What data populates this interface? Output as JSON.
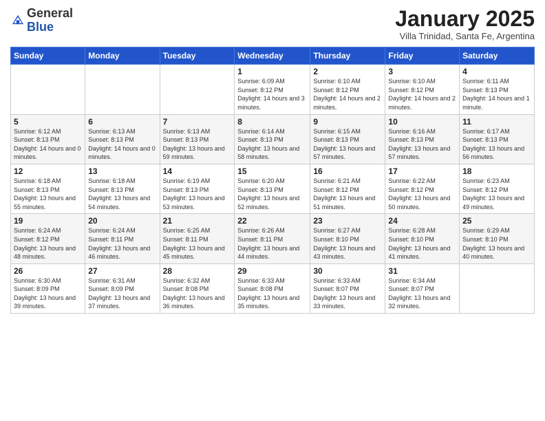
{
  "logo": {
    "general": "General",
    "blue": "Blue"
  },
  "header": {
    "title": "January 2025",
    "subtitle": "Villa Trinidad, Santa Fe, Argentina"
  },
  "weekdays": [
    "Sunday",
    "Monday",
    "Tuesday",
    "Wednesday",
    "Thursday",
    "Friday",
    "Saturday"
  ],
  "weeks": [
    [
      {
        "day": "",
        "info": ""
      },
      {
        "day": "",
        "info": ""
      },
      {
        "day": "",
        "info": ""
      },
      {
        "day": "1",
        "info": "Sunrise: 6:09 AM\nSunset: 8:12 PM\nDaylight: 14 hours and 3 minutes."
      },
      {
        "day": "2",
        "info": "Sunrise: 6:10 AM\nSunset: 8:12 PM\nDaylight: 14 hours and 2 minutes."
      },
      {
        "day": "3",
        "info": "Sunrise: 6:10 AM\nSunset: 8:12 PM\nDaylight: 14 hours and 2 minutes."
      },
      {
        "day": "4",
        "info": "Sunrise: 6:11 AM\nSunset: 8:13 PM\nDaylight: 14 hours and 1 minute."
      }
    ],
    [
      {
        "day": "5",
        "info": "Sunrise: 6:12 AM\nSunset: 8:13 PM\nDaylight: 14 hours and 0 minutes."
      },
      {
        "day": "6",
        "info": "Sunrise: 6:13 AM\nSunset: 8:13 PM\nDaylight: 14 hours and 0 minutes."
      },
      {
        "day": "7",
        "info": "Sunrise: 6:13 AM\nSunset: 8:13 PM\nDaylight: 13 hours and 59 minutes."
      },
      {
        "day": "8",
        "info": "Sunrise: 6:14 AM\nSunset: 8:13 PM\nDaylight: 13 hours and 58 minutes."
      },
      {
        "day": "9",
        "info": "Sunrise: 6:15 AM\nSunset: 8:13 PM\nDaylight: 13 hours and 57 minutes."
      },
      {
        "day": "10",
        "info": "Sunrise: 6:16 AM\nSunset: 8:13 PM\nDaylight: 13 hours and 57 minutes."
      },
      {
        "day": "11",
        "info": "Sunrise: 6:17 AM\nSunset: 8:13 PM\nDaylight: 13 hours and 56 minutes."
      }
    ],
    [
      {
        "day": "12",
        "info": "Sunrise: 6:18 AM\nSunset: 8:13 PM\nDaylight: 13 hours and 55 minutes."
      },
      {
        "day": "13",
        "info": "Sunrise: 6:18 AM\nSunset: 8:13 PM\nDaylight: 13 hours and 54 minutes."
      },
      {
        "day": "14",
        "info": "Sunrise: 6:19 AM\nSunset: 8:13 PM\nDaylight: 13 hours and 53 minutes."
      },
      {
        "day": "15",
        "info": "Sunrise: 6:20 AM\nSunset: 8:13 PM\nDaylight: 13 hours and 52 minutes."
      },
      {
        "day": "16",
        "info": "Sunrise: 6:21 AM\nSunset: 8:12 PM\nDaylight: 13 hours and 51 minutes."
      },
      {
        "day": "17",
        "info": "Sunrise: 6:22 AM\nSunset: 8:12 PM\nDaylight: 13 hours and 50 minutes."
      },
      {
        "day": "18",
        "info": "Sunrise: 6:23 AM\nSunset: 8:12 PM\nDaylight: 13 hours and 49 minutes."
      }
    ],
    [
      {
        "day": "19",
        "info": "Sunrise: 6:24 AM\nSunset: 8:12 PM\nDaylight: 13 hours and 48 minutes."
      },
      {
        "day": "20",
        "info": "Sunrise: 6:24 AM\nSunset: 8:11 PM\nDaylight: 13 hours and 46 minutes."
      },
      {
        "day": "21",
        "info": "Sunrise: 6:25 AM\nSunset: 8:11 PM\nDaylight: 13 hours and 45 minutes."
      },
      {
        "day": "22",
        "info": "Sunrise: 6:26 AM\nSunset: 8:11 PM\nDaylight: 13 hours and 44 minutes."
      },
      {
        "day": "23",
        "info": "Sunrise: 6:27 AM\nSunset: 8:10 PM\nDaylight: 13 hours and 43 minutes."
      },
      {
        "day": "24",
        "info": "Sunrise: 6:28 AM\nSunset: 8:10 PM\nDaylight: 13 hours and 41 minutes."
      },
      {
        "day": "25",
        "info": "Sunrise: 6:29 AM\nSunset: 8:10 PM\nDaylight: 13 hours and 40 minutes."
      }
    ],
    [
      {
        "day": "26",
        "info": "Sunrise: 6:30 AM\nSunset: 8:09 PM\nDaylight: 13 hours and 39 minutes."
      },
      {
        "day": "27",
        "info": "Sunrise: 6:31 AM\nSunset: 8:09 PM\nDaylight: 13 hours and 37 minutes."
      },
      {
        "day": "28",
        "info": "Sunrise: 6:32 AM\nSunset: 8:08 PM\nDaylight: 13 hours and 36 minutes."
      },
      {
        "day": "29",
        "info": "Sunrise: 6:33 AM\nSunset: 8:08 PM\nDaylight: 13 hours and 35 minutes."
      },
      {
        "day": "30",
        "info": "Sunrise: 6:33 AM\nSunset: 8:07 PM\nDaylight: 13 hours and 33 minutes."
      },
      {
        "day": "31",
        "info": "Sunrise: 6:34 AM\nSunset: 8:07 PM\nDaylight: 13 hours and 32 minutes."
      },
      {
        "day": "",
        "info": ""
      }
    ]
  ]
}
